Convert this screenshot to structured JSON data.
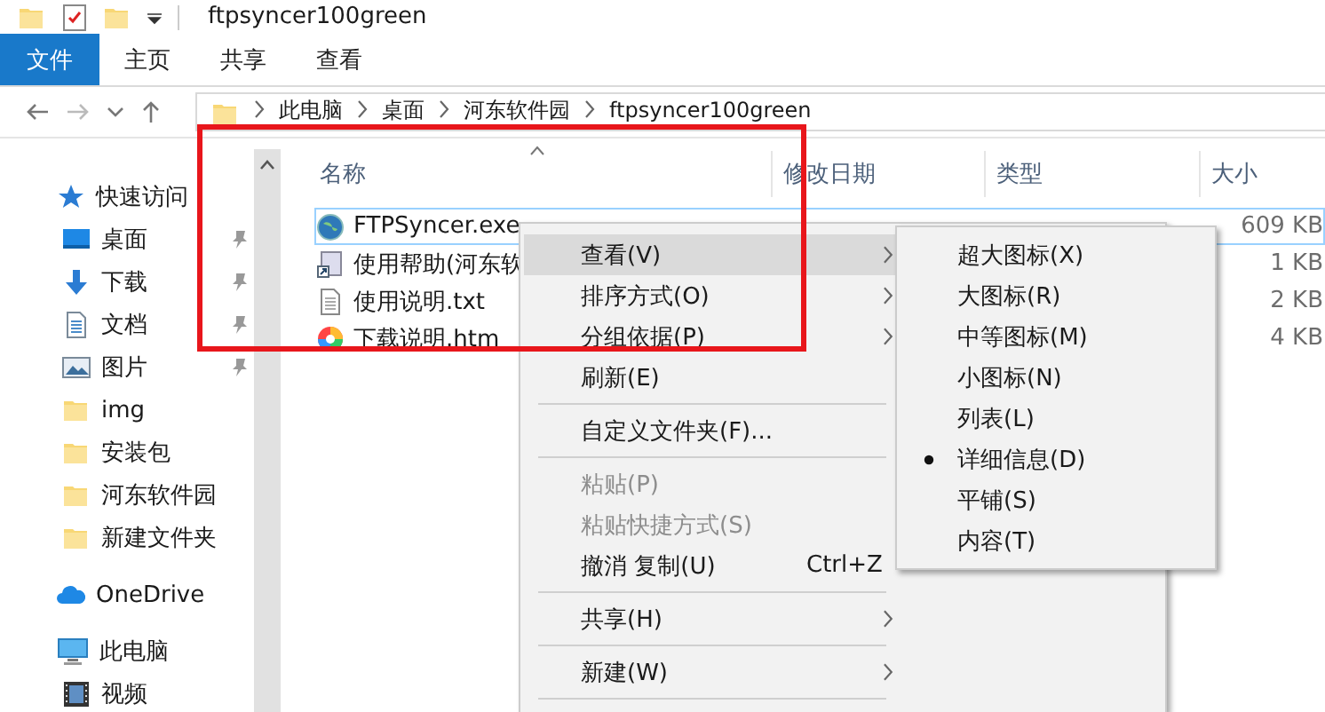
{
  "title_bar": {
    "title": "ftpsyncer100green"
  },
  "ribbon": {
    "tabs": [
      {
        "label": "文件",
        "kind": "file",
        "selected": false
      },
      {
        "label": "主页",
        "kind": "tab",
        "selected": false
      },
      {
        "label": "共享",
        "kind": "tab",
        "selected": false
      },
      {
        "label": "查看",
        "kind": "tab",
        "selected": false
      }
    ]
  },
  "address_bar": {
    "path": [
      "此电脑",
      "桌面",
      "河东软件园",
      "ftpsyncer100green"
    ]
  },
  "navigation": {
    "items": [
      {
        "label": "快速访问",
        "kind": "star",
        "pinned": false,
        "children": [
          {
            "label": "桌面",
            "kind": "desktop",
            "pinned": true
          },
          {
            "label": "下载",
            "kind": "download",
            "pinned": true
          },
          {
            "label": "文档",
            "kind": "document",
            "pinned": true
          },
          {
            "label": "图片",
            "kind": "picture",
            "pinned": true
          },
          {
            "label": "img",
            "kind": "folder",
            "pinned": false
          },
          {
            "label": "安装包",
            "kind": "folder",
            "pinned": false
          },
          {
            "label": "河东软件园",
            "kind": "folder",
            "pinned": false
          },
          {
            "label": "新建文件夹",
            "kind": "folder",
            "pinned": false
          }
        ]
      },
      {
        "label": "OneDrive",
        "kind": "cloud",
        "pinned": false
      },
      {
        "label": "此电脑",
        "kind": "pc",
        "pinned": false,
        "children": [
          {
            "label": "视频",
            "kind": "video",
            "pinned": false
          }
        ]
      }
    ]
  },
  "file_list": {
    "columns": [
      {
        "label": "名称",
        "sorted": true
      },
      {
        "label": "修改日期",
        "sorted": false
      },
      {
        "label": "类型",
        "sorted": false
      },
      {
        "label": "大小",
        "sorted": false
      }
    ],
    "rows": [
      {
        "name": "FTPSyncer.exe",
        "kind": "exe",
        "size": "609 KB",
        "selected": true
      },
      {
        "name": "使用帮助(河东软",
        "kind": "shortcut",
        "size": "1 KB",
        "selected": false
      },
      {
        "name": "使用说明.txt",
        "kind": "text",
        "size": "2 KB",
        "selected": false
      },
      {
        "name": "下载说明.htm",
        "kind": "web",
        "size": "4 KB",
        "selected": false
      }
    ]
  },
  "context_menu": {
    "items": [
      {
        "kind": "item",
        "label": "查看(V)",
        "submenu": true,
        "highlighted": true,
        "disabled": false
      },
      {
        "kind": "item",
        "label": "排序方式(O)",
        "submenu": true,
        "highlighted": false,
        "disabled": false
      },
      {
        "kind": "item",
        "label": "分组依据(P)",
        "submenu": true,
        "highlighted": false,
        "disabled": false
      },
      {
        "kind": "item",
        "label": "刷新(E)",
        "submenu": false,
        "highlighted": false,
        "disabled": false
      },
      {
        "kind": "separator"
      },
      {
        "kind": "item",
        "label": "自定义文件夹(F)...",
        "submenu": false,
        "highlighted": false,
        "disabled": false
      },
      {
        "kind": "separator"
      },
      {
        "kind": "item",
        "label": "粘贴(P)",
        "submenu": false,
        "highlighted": false,
        "disabled": true
      },
      {
        "kind": "item",
        "label": "粘贴快捷方式(S)",
        "submenu": false,
        "highlighted": false,
        "disabled": true
      },
      {
        "kind": "item",
        "label": "撤消 复制(U)",
        "shortcut": "Ctrl+Z",
        "submenu": false,
        "highlighted": false,
        "disabled": false
      },
      {
        "kind": "separator"
      },
      {
        "kind": "item",
        "label": "共享(H)",
        "submenu": true,
        "highlighted": false,
        "disabled": false
      },
      {
        "kind": "separator"
      },
      {
        "kind": "item",
        "label": "新建(W)",
        "submenu": true,
        "highlighted": false,
        "disabled": false
      },
      {
        "kind": "separator"
      }
    ]
  },
  "submenu": {
    "items": [
      {
        "label": "超大图标(X)",
        "selected": false
      },
      {
        "label": "大图标(R)",
        "selected": false
      },
      {
        "label": "中等图标(M)",
        "selected": false
      },
      {
        "label": "小图标(N)",
        "selected": false
      },
      {
        "label": "列表(L)",
        "selected": false
      },
      {
        "label": "详细信息(D)",
        "selected": true
      },
      {
        "label": "平铺(S)",
        "selected": false
      },
      {
        "label": "内容(T)",
        "selected": false
      }
    ]
  },
  "annotations": [
    {
      "kind": "frame"
    }
  ]
}
